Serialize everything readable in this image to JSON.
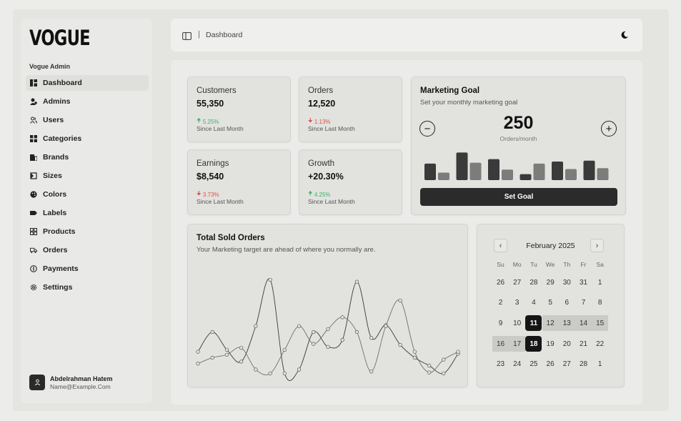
{
  "brand": {
    "logo": "VOGUE",
    "section_label": "Vogue Admin"
  },
  "sidebar": {
    "items": [
      {
        "label": "Dashboard",
        "icon": "dashboard-icon",
        "active": true
      },
      {
        "label": "Admins",
        "icon": "admin-icon"
      },
      {
        "label": "Users",
        "icon": "users-icon"
      },
      {
        "label": "Categories",
        "icon": "grid-icon"
      },
      {
        "label": "Brands",
        "icon": "brands-icon"
      },
      {
        "label": "Sizes",
        "icon": "sizes-icon"
      },
      {
        "label": "Colors",
        "icon": "palette-icon"
      },
      {
        "label": "Labels",
        "icon": "label-icon"
      },
      {
        "label": "Products",
        "icon": "products-icon"
      },
      {
        "label": "Orders",
        "icon": "truck-icon"
      },
      {
        "label": "Payments",
        "icon": "payments-icon"
      },
      {
        "label": "Settings",
        "icon": "gear-icon"
      }
    ],
    "user": {
      "name": "Abdelrahman Hatem",
      "email": "Name@Example.Com"
    }
  },
  "header": {
    "breadcrumb": "Dashboard",
    "separator": "|"
  },
  "stats": {
    "customers": {
      "label": "Customers",
      "value": "55,350",
      "change": "5.25%",
      "direction": "up",
      "since": "Since Last Month"
    },
    "orders": {
      "label": "Orders",
      "value": "12,520",
      "change": "1.13%",
      "direction": "down",
      "since": "Since Last Month"
    },
    "earnings": {
      "label": "Earnings",
      "value": "$8,540",
      "change": "3.73%",
      "direction": "down",
      "since": "Since Last Month"
    },
    "growth": {
      "label": "Growth",
      "value": "+20.30%",
      "change": "4.25%",
      "direction": "up",
      "since": "Since Last Month"
    }
  },
  "marketing_goal": {
    "title": "Marketing Goal",
    "subtitle": "Set your monthly marketing goal",
    "value": "250",
    "unit": "Orders/month",
    "decrease_symbol": "−",
    "increase_symbol": "+",
    "set_goal_label": "Set Goal",
    "bars": [
      {
        "dark": 0.55,
        "light": 0.25
      },
      {
        "dark": 0.92,
        "light": 0.58
      },
      {
        "dark": 0.7,
        "light": 0.35
      },
      {
        "dark": 0.2,
        "light": 0.55
      },
      {
        "dark": 0.62,
        "light": 0.37
      },
      {
        "dark": 0.65,
        "light": 0.4
      }
    ]
  },
  "total_sold": {
    "title": "Total Sold Orders",
    "subtitle": "Your Marketing target are ahead of where you normally are."
  },
  "chart_data": {
    "type": "line",
    "title": "Total Sold Orders",
    "x": [
      0,
      1,
      2,
      3,
      4,
      5,
      6,
      7,
      8,
      9,
      10,
      11,
      12,
      13,
      14,
      15,
      16,
      17,
      18
    ],
    "series": [
      {
        "values": [
          0.26,
          0.46,
          0.28,
          0.16,
          0.52,
          0.99,
          0.04,
          0.08,
          0.46,
          0.31,
          0.38,
          0.97,
          0.4,
          0.53,
          0.33,
          0.2,
          0.12,
          0.04,
          0.24
        ]
      },
      {
        "values": [
          0.14,
          0.2,
          0.23,
          0.3,
          0.08,
          0.04,
          0.28,
          0.52,
          0.34,
          0.49,
          0.61,
          0.46,
          0.06,
          0.52,
          0.78,
          0.26,
          0.05,
          0.18,
          0.26
        ]
      }
    ],
    "ylim": [
      0,
      1
    ],
    "grid": false,
    "legend": "none"
  },
  "calendar": {
    "month": "February 2025",
    "prev_symbol": "‹",
    "next_symbol": "›",
    "weekdays": [
      "Su",
      "Mo",
      "Tu",
      "We",
      "Th",
      "Fr",
      "Sa"
    ],
    "weeks": [
      [
        "26",
        "27",
        "28",
        "29",
        "30",
        "31",
        "1"
      ],
      [
        "2",
        "3",
        "4",
        "5",
        "6",
        "7",
        "8"
      ],
      [
        "9",
        "10",
        "11",
        "12",
        "13",
        "14",
        "15"
      ],
      [
        "16",
        "17",
        "18",
        "19",
        "20",
        "21",
        "22"
      ],
      [
        "23",
        "24",
        "25",
        "26",
        "27",
        "28",
        "1"
      ]
    ],
    "selected_start": "11",
    "selected_end": "18"
  }
}
